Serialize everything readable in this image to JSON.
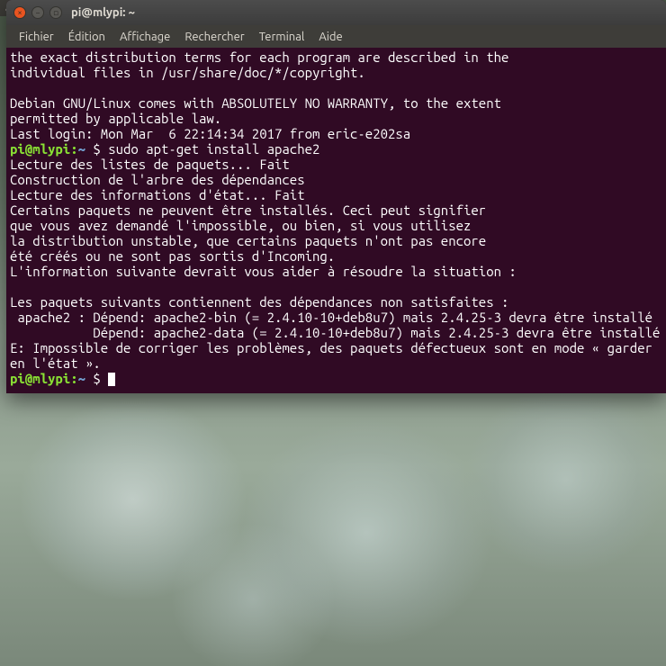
{
  "fragment": "al",
  "window": {
    "title": "pi@mlypi: ~"
  },
  "menubar": {
    "items": [
      "Fichier",
      "Édition",
      "Affichage",
      "Rechercher",
      "Terminal",
      "Aide"
    ]
  },
  "prompt": {
    "userhost": "pi@mlypi",
    "sep": ":",
    "path": "~",
    "sigil": "$"
  },
  "terminal": {
    "pre1": "the exact distribution terms for each program are described in the\nindividual files in /usr/share/doc/*/copyright.\n\nDebian GNU/Linux comes with ABSOLUTELY NO WARRANTY, to the extent\npermitted by applicable law.\nLast login: Mon Mar  6 22:14:34 2017 from eric-e202sa",
    "cmd1": "sudo apt-get install apache2",
    "out1": "Lecture des listes de paquets... Fait\nConstruction de l'arbre des dépendances\nLecture des informations d'état... Fait\nCertains paquets ne peuvent être installés. Ceci peut signifier\nque vous avez demandé l'impossible, ou bien, si vous utilisez\nla distribution unstable, que certains paquets n'ont pas encore\nété créés ou ne sont pas sortis d'Incoming.\nL'information suivante devrait vous aider à résoudre la situation :\n\nLes paquets suivants contiennent des dépendances non satisfaites :\n apache2 : Dépend: apache2-bin (= 2.4.10-10+deb8u7) mais 2.4.25-3 devra être installé\n           Dépend: apache2-data (= 2.4.10-10+deb8u7) mais 2.4.25-3 devra être installé\nE: Impossible de corriger les problèmes, des paquets défectueux sont en mode « garder en l'état »."
  }
}
